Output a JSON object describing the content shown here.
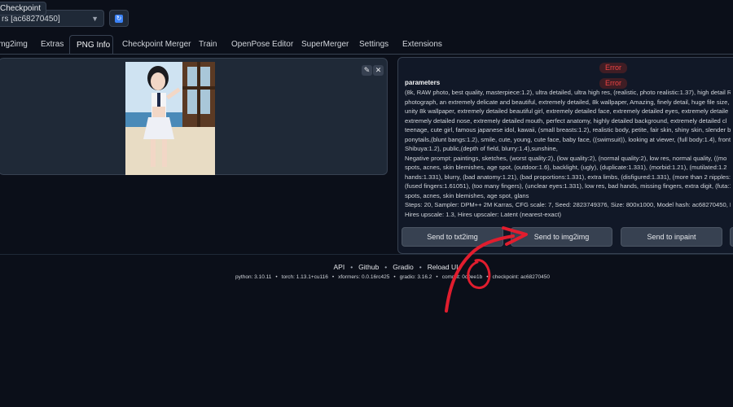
{
  "checkpoint": {
    "label": "Checkpoint",
    "value": "rs [ac68270450]",
    "refresh_icon": "refresh-icon"
  },
  "tabs": [
    "img2img",
    "Extras",
    "PNG Info",
    "Checkpoint Merger",
    "Train",
    "OpenPose Editor",
    "SuperMerger",
    "Settings",
    "Extensions"
  ],
  "active_tab": "PNG Info",
  "image_panel": {
    "edit_icon": "✎",
    "close_icon": "✕"
  },
  "errors": [
    "Error",
    "Error"
  ],
  "params": {
    "title": "parameters",
    "lines": [
      "(8k, RAW photo, best quality, masterpiece:1.2), ultra detailed, ultra high res, (realistic, photo realistic:1.37), high detail RA",
      "photograph, an extremely delicate and beautiful, extremely detailed, 8k wallpaper, Amazing, finely detail, huge file size,",
      "unity 8k wallpaper, extremely detailed beautiful girl, extremely detailed face, extremely detailed eyes, extremely detaile",
      "extremely detailed nose, extremely detailed mouth, perfect anatomy, highly detailed background, extremely detailed cl",
      "teenage, cute girl, famous japanese idol, kawaii, (small breasts:1.2), realistic body, petite, fair skin, shiny skin, slender bo",
      "ponytails,(blunt bangs:1.2), smile, cute, young, cute face, baby face, ((swimsuit)), looking at viewer, (full body:1.4), front",
      "Shibuya:1.2), public,(depth of field, blurry:1.4),sunshine,",
      "Negative prompt: paintings, sketches, (worst quality:2), (low quality:2), (normal quality:2), low res, normal quality, ((mo",
      "spots, acnes, skin blemishes, age spot, (outdoor:1.6), backlight, (ugly), (duplicate:1.331), (morbid:1.21), (mutilated:1.2",
      "hands:1.331), blurry, (bad anatomy:1.21), (bad proportions:1.331), extra limbs, (disfigured:1.331), (more than 2 nipples:1",
      "(fused fingers:1.61051), (too many fingers), (unclear eyes:1.331), low res, bad hands, missing fingers, extra digit, (futa:1.",
      "spots, acnes, skin blemishes, age spot, glans",
      "Steps: 20, Sampler: DPM++ 2M Karras, CFG scale: 7, Seed: 2823749376, Size: 800x1000, Model hash: ac68270450, Model: I",
      "Hires upscale: 1.3, Hires upscaler: Latent (nearest-exact)"
    ]
  },
  "send_buttons": [
    "Send to txt2img",
    "Send to img2img",
    "Send to inpaint"
  ],
  "footer": {
    "links": [
      "API",
      "Github",
      "Gradio",
      "Reload UI"
    ],
    "versions": [
      "python: 3.10.11",
      "torch: 1.13.1+cu116",
      "xformers: 0.0.16rc425",
      "gradio: 3.16.2",
      "commit: 0c0ee1b",
      "checkpoint: ac68270450"
    ]
  },
  "colors": {
    "background": "#0b0f19",
    "panel": "#1f2937",
    "error": "#ef4444",
    "annotation": "#e11d2e"
  }
}
